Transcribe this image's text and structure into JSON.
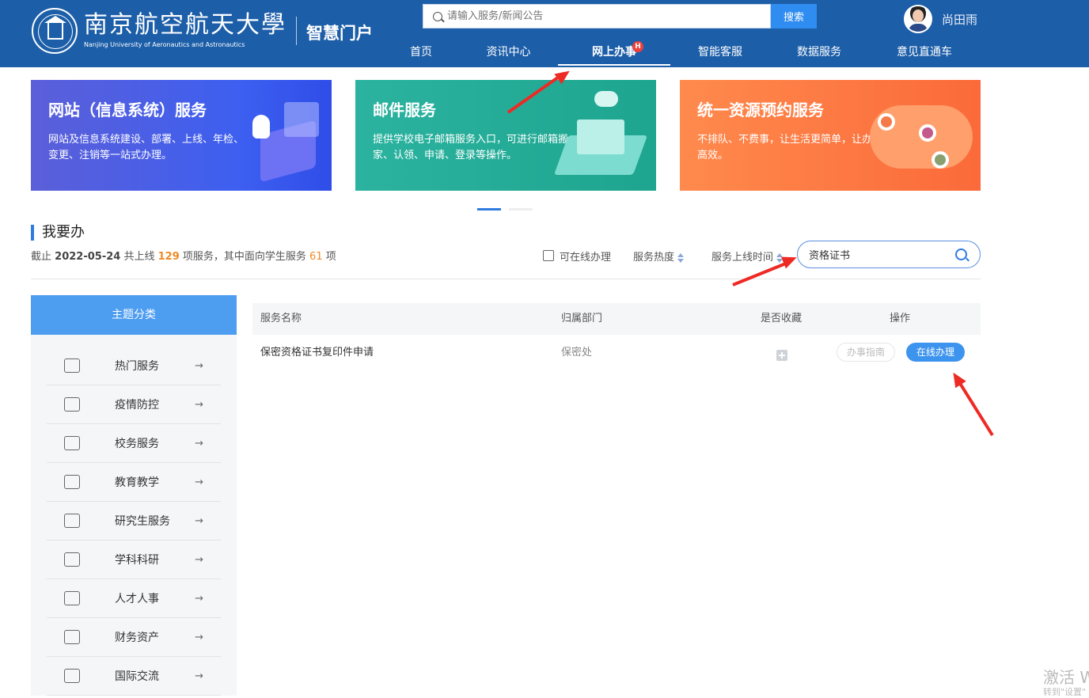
{
  "header": {
    "logo_cn": "南京航空航天大學",
    "logo_en": "Nanjing University of Aeronautics and Astronautics",
    "portal_name": "智慧门户",
    "search_placeholder": "请输入服务/新闻公告",
    "search_button": "搜索",
    "user_name": "尚田雨"
  },
  "nav": [
    {
      "label": "首页"
    },
    {
      "label": "资讯中心"
    },
    {
      "label": "网上办事",
      "badge": "H",
      "active": true
    },
    {
      "label": "智能客服"
    },
    {
      "label": "数据服务"
    },
    {
      "label": "意见直通车"
    }
  ],
  "banners": [
    {
      "title": "网站（信息系统）服务",
      "desc": "网站及信息系统建设、部署、上线、年检、变更、注销等一站式办理。",
      "color": "#3d5ff0"
    },
    {
      "title": "邮件服务",
      "desc": "提供学校电子邮箱服务入口，可进行邮箱搬家、认领、申请、登录等操作。",
      "color": "#1ea58f"
    },
    {
      "title": "统一资源预约服务",
      "desc": "不排队、不费事，让生活更简单，让办事更高效。",
      "color": "#fb6a3a"
    }
  ],
  "section": {
    "title": "我要办",
    "summary_prefix": "截止",
    "date": "2022-05-24",
    "summary_mid": "共上线",
    "total": "129",
    "summary_mid2": "项服务，其中面向学生服务",
    "student": "61",
    "summary_suffix": "项"
  },
  "filters": {
    "online_only": "可在线办理",
    "sort_heat": "服务热度",
    "sort_time": "服务上线时间",
    "keyword": "资格证书"
  },
  "sidebar": {
    "header": "主题分类",
    "items": [
      {
        "label": "热门服务",
        "icon": "server-icon"
      },
      {
        "label": "疫情防控",
        "icon": "atom-icon"
      },
      {
        "label": "校务服务",
        "icon": "tie-icon"
      },
      {
        "label": "教育教学",
        "icon": "coins-icon"
      },
      {
        "label": "研究生服务",
        "icon": "graduate-icon"
      },
      {
        "label": "学科科研",
        "icon": "compass-icon"
      },
      {
        "label": "人才人事",
        "icon": "network-icon"
      },
      {
        "label": "财务资产",
        "icon": "ledger-icon"
      },
      {
        "label": "国际交流",
        "icon": "grid-icon"
      }
    ],
    "arrow": "→"
  },
  "table": {
    "headers": [
      "服务名称",
      "归属部门",
      "是否收藏",
      "操作"
    ],
    "rows": [
      {
        "name": "保密资格证书复印件申请",
        "dept": "保密处",
        "guide": "办事指南",
        "online": "在线办理"
      }
    ]
  },
  "watermark": {
    "line1": "激活 W",
    "line2": "转到\"设置\""
  },
  "colors": {
    "header_bg": "#1c5ea8",
    "accent": "#2f7be0",
    "annotation_arrow": "#ee2a24"
  }
}
